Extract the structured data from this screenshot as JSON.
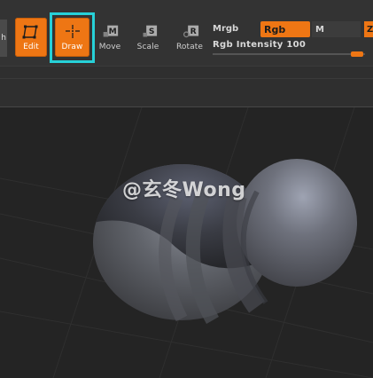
{
  "toolbar": {
    "left_stub_label": "h",
    "edit_label": "Edit",
    "draw_label": "Draw",
    "move_label": "Move",
    "scale_label": "Scale",
    "rotate_label": "Rotate",
    "move_key": "M",
    "scale_key": "S",
    "rotate_key": "R"
  },
  "color_panel": {
    "mrgb_label": "Mrgb",
    "rgb_label": "Rgb",
    "m_label": "M",
    "z_label": "Z",
    "intensity_label": "Rgb Intensity",
    "intensity_value": "100"
  },
  "viewport": {
    "watermark": "@玄冬Wong"
  },
  "colors": {
    "accent": "#ee7614",
    "highlight": "#27d1d8",
    "panel": "#333333",
    "viewport": "#242424"
  }
}
